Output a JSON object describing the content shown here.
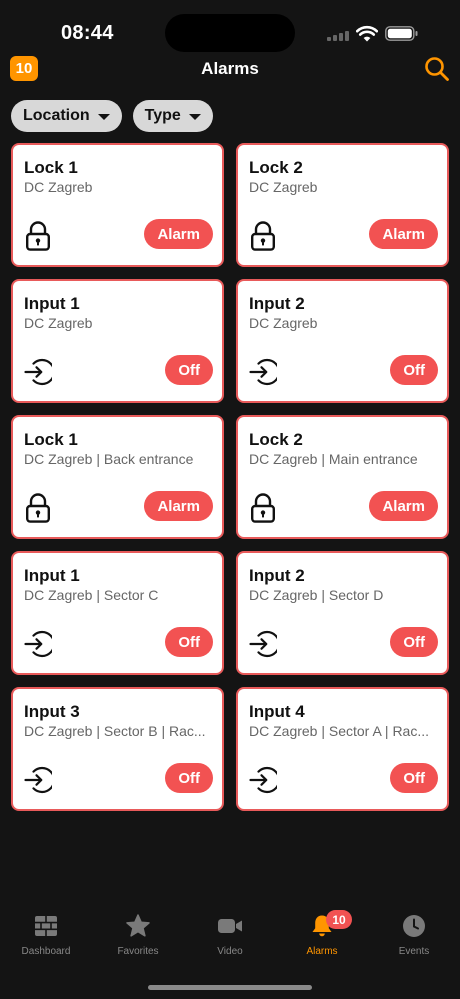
{
  "status_bar": {
    "time": "08:44"
  },
  "header": {
    "badge_count": "10",
    "title": "Alarms"
  },
  "filters": [
    {
      "label": "Location"
    },
    {
      "label": "Type"
    }
  ],
  "cards": [
    {
      "title": "Lock 1",
      "subtitle": "DC Zagreb",
      "icon": "lock-icon",
      "status": "Alarm"
    },
    {
      "title": "Lock 2",
      "subtitle": "DC Zagreb",
      "icon": "lock-icon",
      "status": "Alarm"
    },
    {
      "title": "Input 1",
      "subtitle": "DC Zagreb",
      "icon": "input-icon",
      "status": "Off"
    },
    {
      "title": "Input 2",
      "subtitle": "DC Zagreb",
      "icon": "input-icon",
      "status": "Off"
    },
    {
      "title": "Lock 1",
      "subtitle": "DC Zagreb | Back entrance",
      "icon": "lock-icon",
      "status": "Alarm"
    },
    {
      "title": "Lock 2",
      "subtitle": "DC Zagreb | Main entrance",
      "icon": "lock-icon",
      "status": "Alarm"
    },
    {
      "title": "Input 1",
      "subtitle": "DC Zagreb | Sector C",
      "icon": "input-icon",
      "status": "Off"
    },
    {
      "title": "Input 2",
      "subtitle": "DC Zagreb | Sector D",
      "icon": "input-icon",
      "status": "Off"
    },
    {
      "title": "Input 3",
      "subtitle": "DC Zagreb | Sector B | Rac...",
      "icon": "input-icon",
      "status": "Off"
    },
    {
      "title": "Input 4",
      "subtitle": "DC Zagreb | Sector A | Rac...",
      "icon": "input-icon",
      "status": "Off"
    }
  ],
  "tabbar": {
    "tabs": [
      {
        "label": "Dashboard",
        "icon": "dashboard-icon",
        "active": false
      },
      {
        "label": "Favorites",
        "icon": "star-icon",
        "active": false
      },
      {
        "label": "Video",
        "icon": "video-camera-icon",
        "active": false
      },
      {
        "label": "Alarms",
        "icon": "bell-icon",
        "active": true,
        "badge": "10"
      },
      {
        "label": "Events",
        "icon": "clock-icon",
        "active": false
      }
    ]
  },
  "colors": {
    "accent": "#ff9500",
    "alarm_red": "#f25252",
    "card_border": "#e85a5a",
    "background": "#141414"
  }
}
